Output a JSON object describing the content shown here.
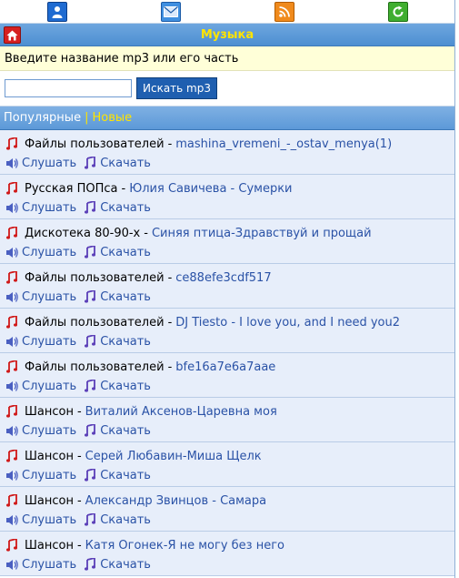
{
  "header": {
    "icons": [
      {
        "name": "user-icon"
      },
      {
        "name": "mail-icon"
      },
      {
        "name": "rss-icon"
      },
      {
        "name": "refresh-icon"
      }
    ],
    "title": "Музыка"
  },
  "search": {
    "prompt": "Введите название mp3 или его часть",
    "input_value": "",
    "button_label": "Искать mp3"
  },
  "tabs": {
    "popular": "Популярные",
    "separator": "|",
    "new": "Новые"
  },
  "actions": {
    "listen": "Слушать",
    "download": "Скачать"
  },
  "colors": {
    "title": "#ffe400",
    "link": "#2a52a6",
    "row_bg": "#e7eefa",
    "prompt_bg": "#ffffd8"
  },
  "tracks": [
    {
      "category": "Файлы пользователей",
      "title": "mashina_vremeni_-_ostav_menya(1)"
    },
    {
      "category": "Русская ПОПса",
      "title": "Юлия Савичева - Сумерки"
    },
    {
      "category": "Дискотека 80-90-х",
      "title": "Синяя птица-Здравствуй и прощай"
    },
    {
      "category": "Файлы пользователей",
      "title": "ce88efe3cdf517"
    },
    {
      "category": "Файлы пользователей",
      "title": "DJ Tiesto - I love you, and I need you2"
    },
    {
      "category": "Файлы пользователей",
      "title": "bfe16a7e6a7aae"
    },
    {
      "category": "Шансон",
      "title": "Виталий Аксенов-Царевна моя"
    },
    {
      "category": "Шансон",
      "title": "Серей Любавин-Миша Щелк"
    },
    {
      "category": "Шансон",
      "title": "Александр Звинцов - Самара"
    },
    {
      "category": "Шансон",
      "title": "Катя Огонек-Я не могу без него"
    }
  ]
}
